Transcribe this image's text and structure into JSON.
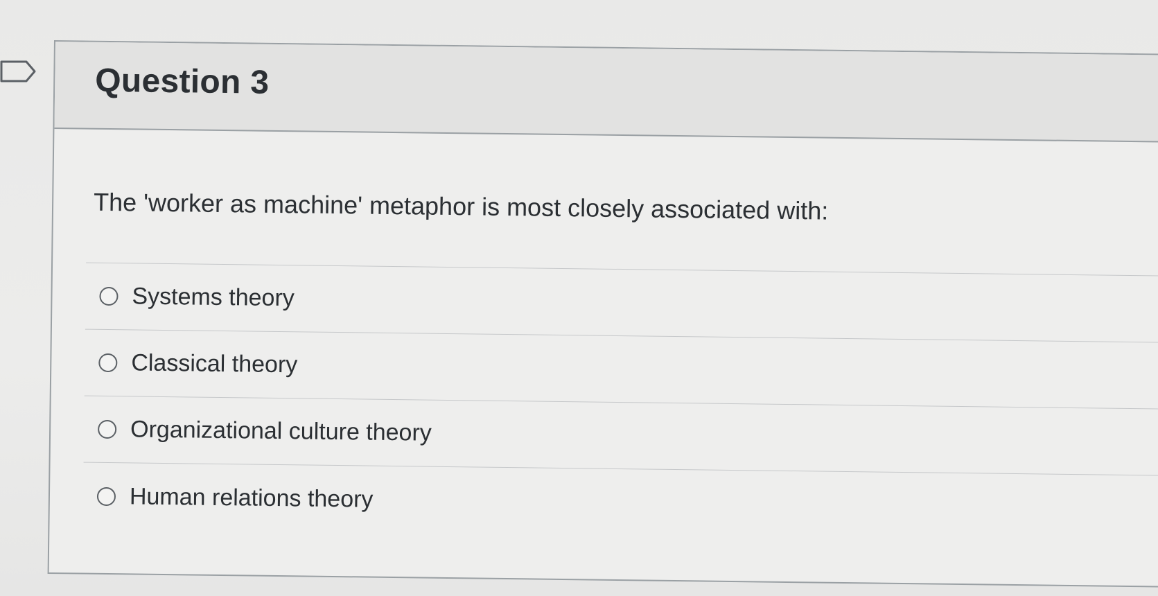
{
  "question": {
    "title": "Question 3",
    "text": "The 'worker as machine' metaphor is most closely associated with:",
    "answers": [
      {
        "label": "Systems theory",
        "selected": false
      },
      {
        "label": "Classical theory",
        "selected": false
      },
      {
        "label": "Organizational culture theory",
        "selected": false
      },
      {
        "label": "Human relations theory",
        "selected": false
      }
    ]
  },
  "icons": {
    "flag": "flag-question-icon"
  },
  "colors": {
    "border": "#9aa0a4",
    "header_bg": "#e2e2e1",
    "text": "#2b2f33"
  }
}
